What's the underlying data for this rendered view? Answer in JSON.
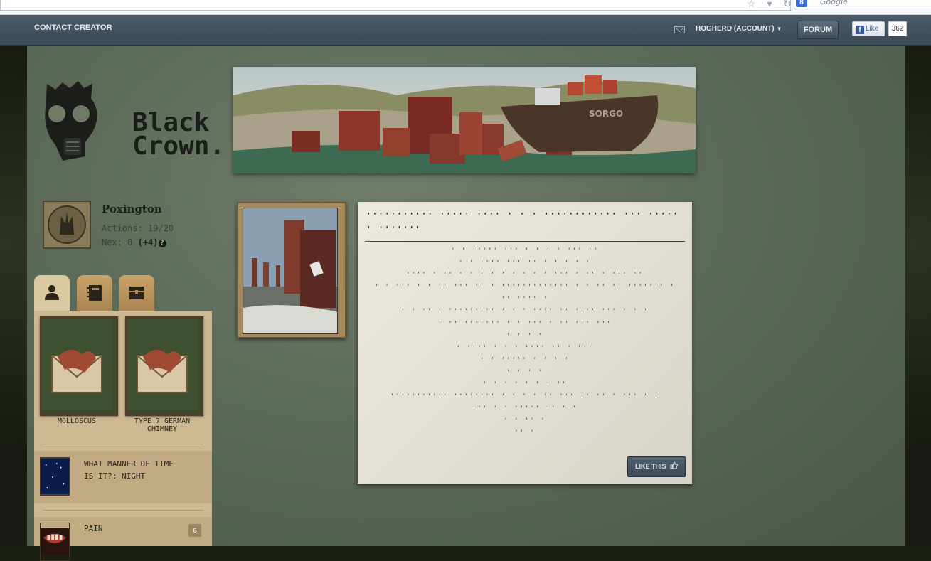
{
  "browser": {
    "search_placeholder": "Google",
    "search_engine_badge": "8",
    "toolbar_icons": "☆ ▾ ↻"
  },
  "topnav": {
    "contact_label": "CONTACT CREATOR",
    "account_label": "HOGHERD (ACCOUNT)",
    "account_chevron": "▼",
    "forum_label": "FORUM",
    "fb_like_label": "Like",
    "fb_icon_letter": "f",
    "fb_count": "362"
  },
  "logo": {
    "line1": "Black",
    "line2": "Crown."
  },
  "banner": {
    "ship_name": "SORGO"
  },
  "character": {
    "name": "Poxington",
    "actions_label": "Actions: 19/20",
    "nex_label": "Nex: 0",
    "nex_bonus": "(+4)",
    "help_icon": "?"
  },
  "tabs": [
    {
      "icon": "person-icon",
      "active": true
    },
    {
      "icon": "notebook-icon",
      "active": false
    },
    {
      "icon": "chest-icon",
      "active": false
    }
  ],
  "cards": [
    {
      "label": "MOLLOSCUS"
    },
    {
      "label": "TYPE 7 GERMAN CHIMNEY"
    }
  ],
  "qualities": [
    {
      "label": "WHAT MANNER OF TIME IS IT?: NIGHT",
      "badge": ""
    },
    {
      "label": "PAIN",
      "badge": "6"
    }
  ],
  "storylet": {
    "title": "''''''''''' ''''' '''' ' ' ' '''''''''''' ''' ''''' ' '''''''",
    "body": [
      "' ' ''''' ''' ' ' ' ' ''' ''",
      "' ' '''' ''' '' ' ' ' ' '",
      "'''' ' '' ' ' ' ' ' ' ' ' ' ''' ' '' ' ''' ''",
      "' ' ''' ' ' '' ''' '' ' ''''''''''''' ' ' '' '' ''''''' '",
      "'' '''' '",
      "' ' '' ' ''''''''' ' ' ' '''' '' '''' ''' ' ' '",
      "' '' ''''''' ' ' ''' ' '' ''' '''",
      "' ' ' '",
      "' '''' ' ' ' '''' '' ' '''",
      "' ' ''''' ' ' ' '",
      "' ' ' '",
      "' ' ' ' ' ' ' ''",
      "''''''''''' '''''''' ' ' ' ' '' ''' '' '' ' ''' ' '",
      "''' ' ' ''''' '' ' '",
      "' ' '' '",
      "'' '"
    ],
    "like_label": "LIKE THIS"
  }
}
